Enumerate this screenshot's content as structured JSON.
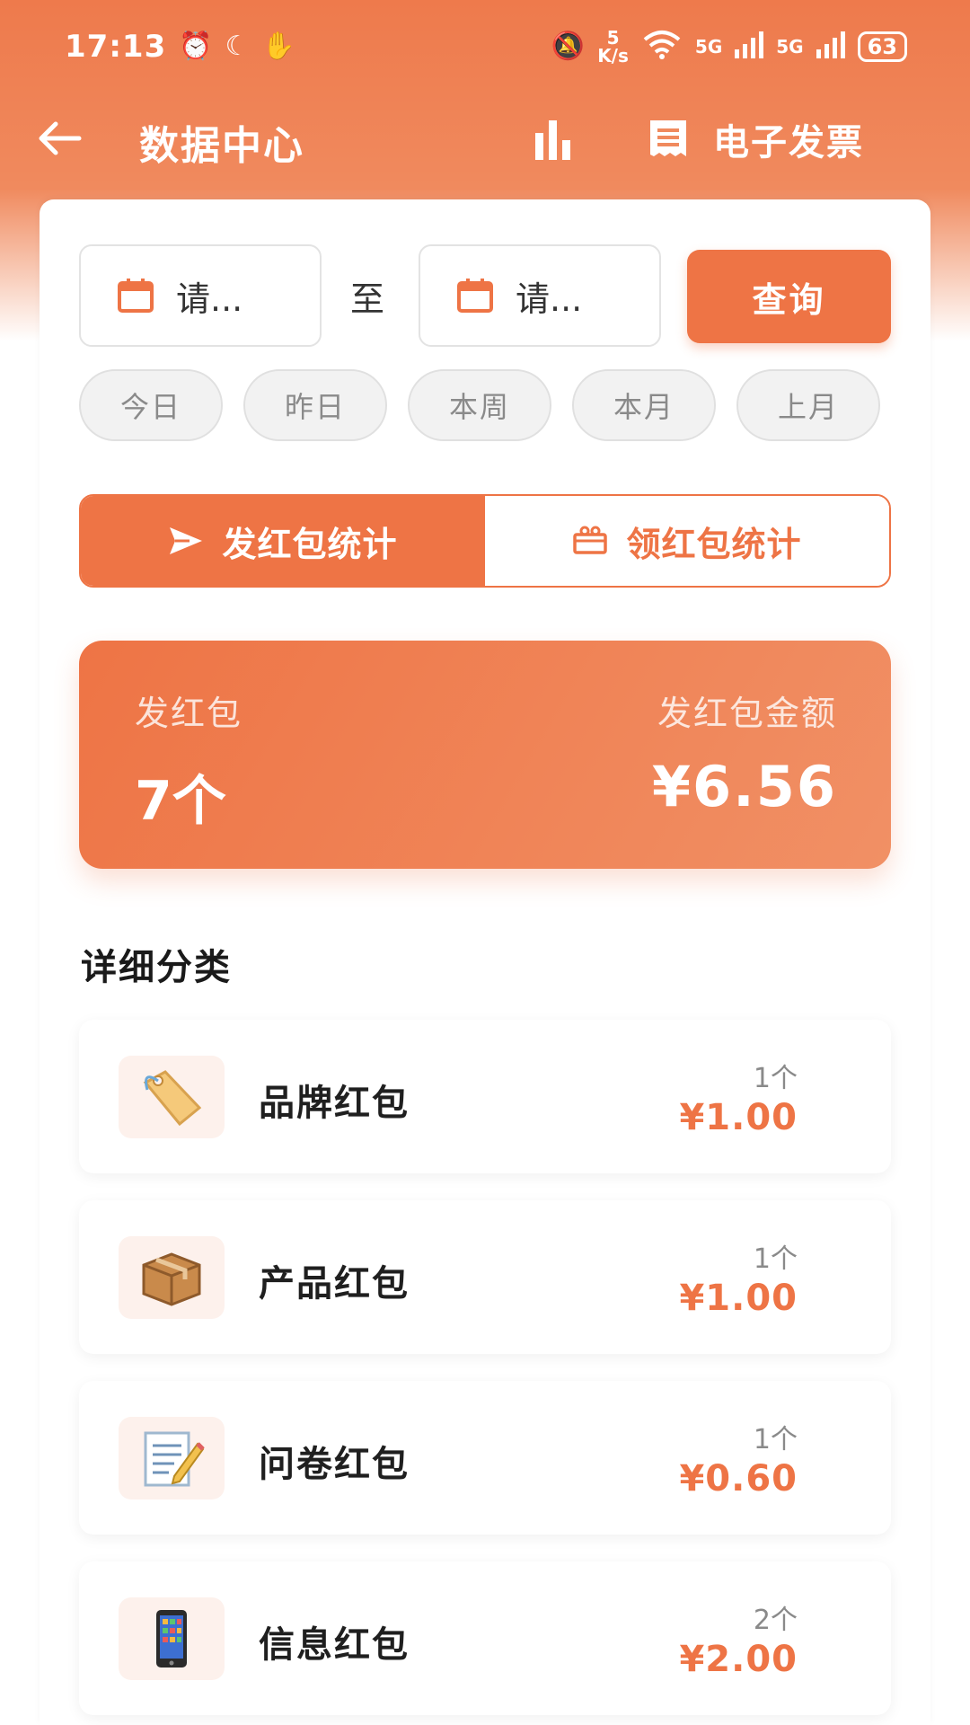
{
  "status_bar": {
    "time": "17:13",
    "net_speed_value": "5",
    "net_speed_unit": "K/s",
    "wifi_label": "6",
    "sim1": "5G",
    "sim2": "5G",
    "battery": "63"
  },
  "header": {
    "title": "数据中心",
    "invoice_label": "电子发票"
  },
  "date_filter": {
    "start_placeholder": "请...",
    "separator": "至",
    "end_placeholder": "请...",
    "query_label": "查询"
  },
  "quick_ranges": [
    "今日",
    "昨日",
    "本周",
    "本月",
    "上月"
  ],
  "tabs": {
    "send_label": "发红包统计",
    "receive_label": "领红包统计"
  },
  "summary": {
    "count_label": "发红包",
    "count_value": "7个",
    "amount_label": "发红包金额",
    "amount_value": "¥6.56"
  },
  "section_title": "详细分类",
  "categories": [
    {
      "name": "品牌红包",
      "count": "1个",
      "amount": "¥1.00",
      "icon": "tag-icon"
    },
    {
      "name": "产品红包",
      "count": "1个",
      "amount": "¥1.00",
      "icon": "package-icon"
    },
    {
      "name": "问卷红包",
      "count": "1个",
      "amount": "¥0.60",
      "icon": "memo-icon"
    },
    {
      "name": "信息红包",
      "count": "2个",
      "amount": "¥2.00",
      "icon": "phone-icon"
    }
  ],
  "colors": {
    "accent": "#ee7445",
    "accent_light": "#f19065",
    "chip_bg": "#f2f2f2"
  }
}
